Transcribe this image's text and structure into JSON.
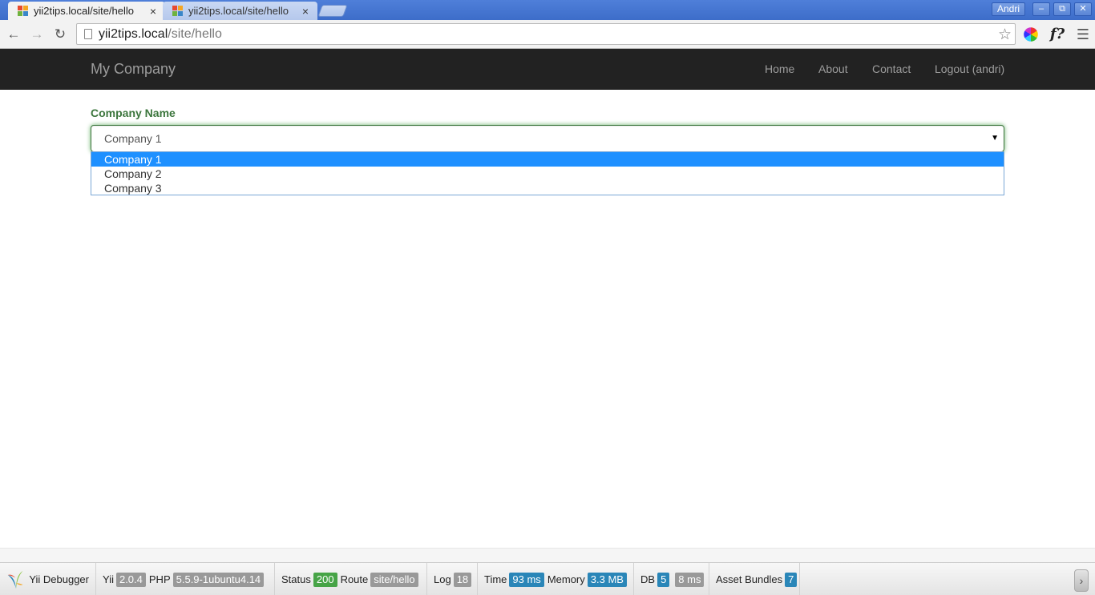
{
  "browser": {
    "tabs": [
      {
        "title": "yii2tips.local/site/hello",
        "close": "×"
      },
      {
        "title": "yii2tips.local/site/hello",
        "close": "×"
      }
    ],
    "profile_name": "Andri",
    "window_controls": {
      "minimize": "–",
      "restore": "⧉",
      "close": "✕"
    },
    "address": {
      "host": "yii2tips.local",
      "path": "/site/hello"
    }
  },
  "navbar": {
    "brand": "My Company",
    "links": [
      "Home",
      "About",
      "Contact",
      "Logout (andri)"
    ]
  },
  "form": {
    "label": "Company Name",
    "selected": "Company 1",
    "options": [
      "Company 1",
      "Company 2",
      "Company 3"
    ]
  },
  "debugger": {
    "title": "Yii Debugger",
    "yii_label": "Yii",
    "yii_version": "2.0.4",
    "php_label": "PHP",
    "php_version": "5.5.9-1ubuntu4.14",
    "status_label": "Status",
    "status": "200",
    "route_label": "Route",
    "route": "site/hello",
    "log_label": "Log",
    "log_count": "18",
    "time_label": "Time",
    "time": "93 ms",
    "memory_label": "Memory",
    "memory": "3.3 MB",
    "db_label": "DB",
    "db_queries": "5",
    "db_time": "8 ms",
    "assets_label": "Asset Bundles",
    "assets_count": "7"
  },
  "colors": {
    "navbar_bg": "#222222",
    "success_green": "#3c763d",
    "option_highlight": "#1e90ff",
    "chrome_blue": "#4f7fd9"
  }
}
